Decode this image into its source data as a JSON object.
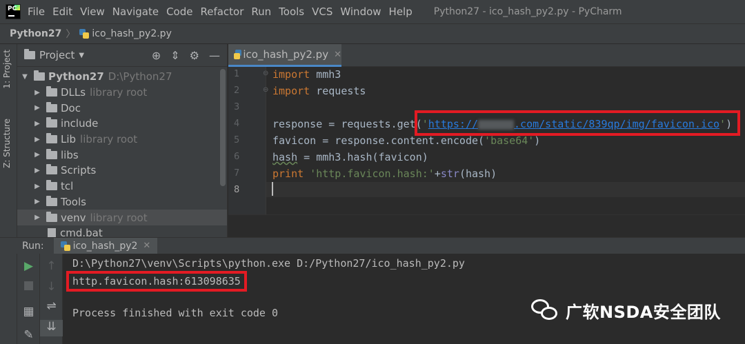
{
  "menubar": {
    "items": [
      "File",
      "Edit",
      "View",
      "Navigate",
      "Code",
      "Refactor",
      "Run",
      "Tools",
      "VCS",
      "Window",
      "Help"
    ],
    "window_title": "Python27 - ico_hash_py2.py - PyCharm"
  },
  "breadcrumb": {
    "project": "Python27",
    "file": "ico_hash_py2.py"
  },
  "stripe": {
    "project_tab": "1: Project",
    "structure_tab": "Z: Structure"
  },
  "project_panel": {
    "title": "Project",
    "root": {
      "name": "Python27",
      "path": "D:\\Python27"
    },
    "items": [
      {
        "name": "DLLs",
        "hint": "library root"
      },
      {
        "name": "Doc",
        "hint": ""
      },
      {
        "name": "include",
        "hint": ""
      },
      {
        "name": "Lib",
        "hint": "library root"
      },
      {
        "name": "libs",
        "hint": ""
      },
      {
        "name": "Scripts",
        "hint": ""
      },
      {
        "name": "tcl",
        "hint": ""
      },
      {
        "name": "Tools",
        "hint": ""
      },
      {
        "name": "venv",
        "hint": "library root"
      },
      {
        "name": "cmd.bat",
        "hint": ""
      }
    ]
  },
  "editor": {
    "tab": "ico_hash_py2.py",
    "line_numbers": [
      "1",
      "2",
      "3",
      "4",
      "5",
      "6",
      "7",
      "8"
    ],
    "code": {
      "l1_kw": "import",
      "l1_rest": " mmh3",
      "l2_kw": "import",
      "l2_rest": " requests",
      "l4_pre": "response = requests.get(",
      "l4_quote_open": "'",
      "l4_url_a": "https://",
      "l4_url_b": ".com/static/839qp/img/favicon.ico",
      "l4_quote_close": "'",
      "l4_post": ")",
      "l5_pre": "favicon = response.content.encode(",
      "l5_str": "'base64'",
      "l5_post": ")",
      "l6_var": "hash",
      "l6_rest": " = mmh3.hash(favicon)",
      "l7_kw": "print",
      "l7_str": " 'http.favicon.hash:'",
      "l7_plus": "+",
      "l7_builtin": "str",
      "l7_post": "(hash)"
    }
  },
  "run": {
    "label": "Run:",
    "tab": "ico_hash_py2",
    "console": [
      "D:\\Python27\\venv\\Scripts\\python.exe D:/Python27/ico_hash_py2.py",
      "http.favicon.hash:613098635",
      "",
      "Process finished with exit code 0"
    ]
  },
  "watermark": {
    "text": "广软NSDA安全团队"
  },
  "colors": {
    "highlight": "#e31b23",
    "keyword": "#cc7832",
    "string": "#6a8759",
    "url": "#287bde"
  }
}
